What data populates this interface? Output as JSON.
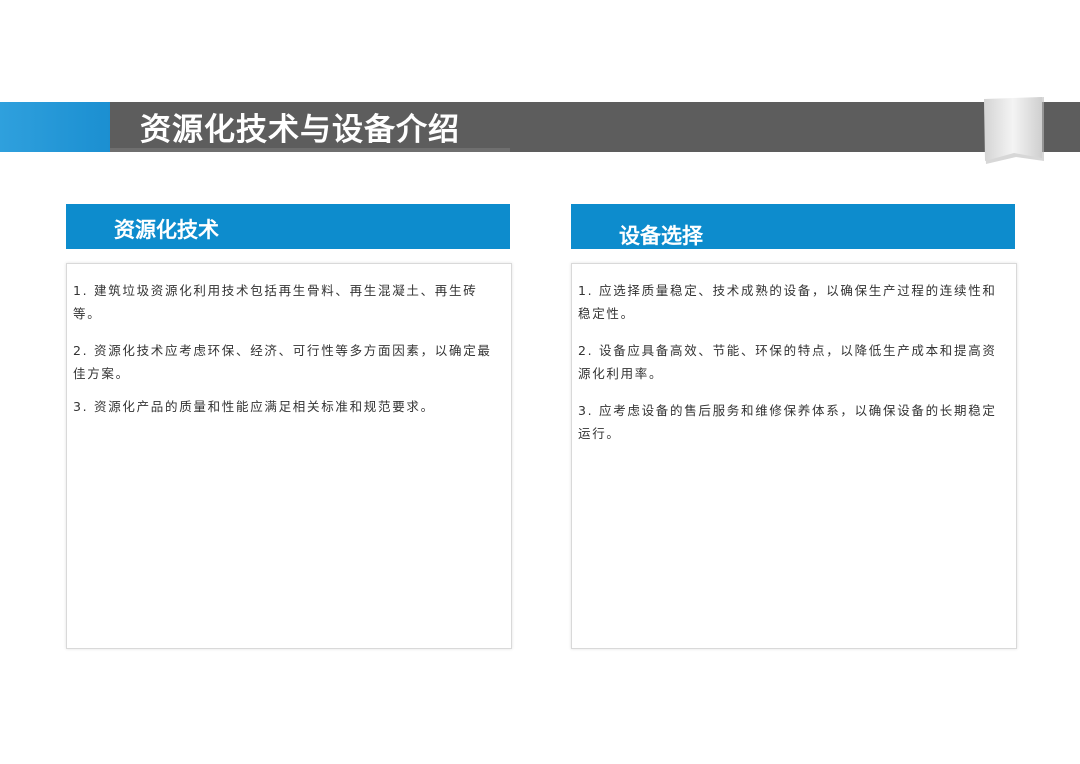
{
  "title": "资源化技术与设备介绍",
  "colors": {
    "title_band": "#5d5d5d",
    "accent_blue": "#1b8fd1",
    "section_header": "#0d8ccd",
    "body_text": "#333333"
  },
  "left": {
    "heading": "资源化技术",
    "items": [
      "1. 建筑垃圾资源化利用技术包括再生骨料、再生混凝土、再生砖等。",
      "2. 资源化技术应考虑环保、经济、可行性等多方面因素，以确定最佳方案。",
      "3. 资源化产品的质量和性能应满足相关标准和规范要求。"
    ]
  },
  "right": {
    "heading": "设备选择",
    "items": [
      "1. 应选择质量稳定、技术成熟的设备，以确保生产过程的连续性和稳定性。",
      "2. 设备应具备高效、节能、环保的特点，以降低生产成本和提高资源化利用率。",
      "3. 应考虑设备的售后服务和维修保养体系，以确保设备的长期稳定运行。"
    ]
  }
}
